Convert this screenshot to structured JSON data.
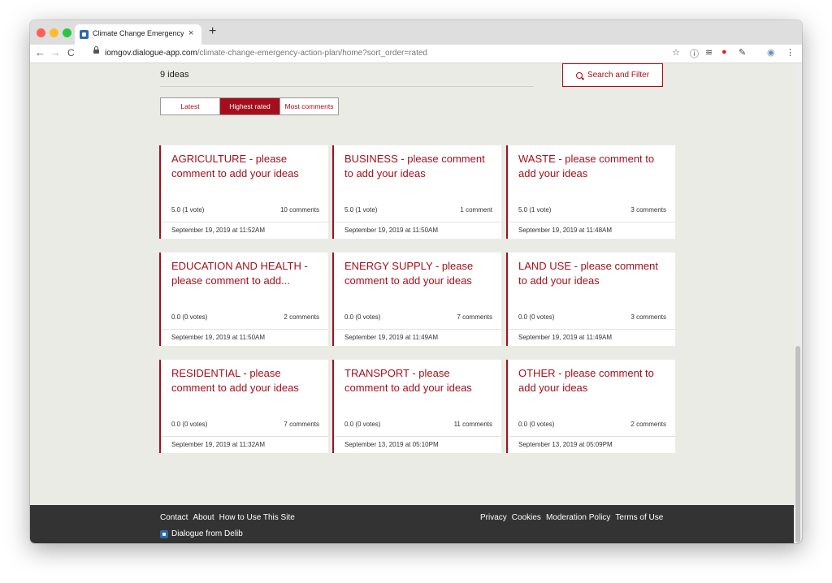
{
  "browser": {
    "tab_title": "Climate Change Emergency Ac",
    "tab_close": "×",
    "new_tab": "+",
    "url_host": "iomgov.dialogue-app.com",
    "url_path": "/climate-change-emergency-action-plan/home?sort_order=rated",
    "nav_back": "←",
    "nav_forward": "→",
    "nav_reload": "C"
  },
  "header": {
    "ideas_count": "9 ideas",
    "search_label": "Search and Filter"
  },
  "sort": {
    "options": [
      "Latest",
      "Highest rated",
      "Most comments"
    ],
    "active": "Highest rated"
  },
  "ideas": [
    {
      "title": "AGRICULTURE - please comment to add your ideas",
      "rating": "5.0 (1 vote)",
      "comments": "10 comments",
      "date": "September 19, 2019 at 11:52AM"
    },
    {
      "title": "BUSINESS - please comment to add your ideas",
      "rating": "5.0 (1 vote)",
      "comments": "1 comment",
      "date": "September 19, 2019 at 11:50AM"
    },
    {
      "title": "WASTE - please comment to add your ideas",
      "rating": "5.0 (1 vote)",
      "comments": "3 comments",
      "date": "September 19, 2019 at 11:48AM"
    },
    {
      "title": "EDUCATION AND HEALTH - please comment to add...",
      "rating": "0.0 (0 votes)",
      "comments": "2 comments",
      "date": "September 19, 2019 at 11:50AM"
    },
    {
      "title": "ENERGY SUPPLY - please comment to add your ideas",
      "rating": "0.0 (0 votes)",
      "comments": "7 comments",
      "date": "September 19, 2019 at 11:49AM"
    },
    {
      "title": "LAND USE - please comment to add your ideas",
      "rating": "0.0 (0 votes)",
      "comments": "3 comments",
      "date": "September 19, 2019 at 11:49AM"
    },
    {
      "title": "RESIDENTIAL - please comment to add your ideas",
      "rating": "0.0 (0 votes)",
      "comments": "7 comments",
      "date": "September 19, 2019 at 11:32AM"
    },
    {
      "title": "TRANSPORT - please comment to add your ideas",
      "rating": "0.0 (0 votes)",
      "comments": "11 comments",
      "date": "September 13, 2019 at 05:10PM"
    },
    {
      "title": "OTHER - please comment to add your ideas",
      "rating": "0.0 (0 votes)",
      "comments": "2 comments",
      "date": "September 13, 2019 at 05:09PM"
    }
  ],
  "footer": {
    "left_links": [
      "Contact",
      "About",
      "How to Use This Site"
    ],
    "right_links": [
      "Privacy",
      "Cookies",
      "Moderation Policy",
      "Terms of Use"
    ],
    "brand": "Dialogue from Delib"
  },
  "colors": {
    "accent": "#a50f1c",
    "page_background": "#ebebe6",
    "footer_background": "#333333"
  }
}
